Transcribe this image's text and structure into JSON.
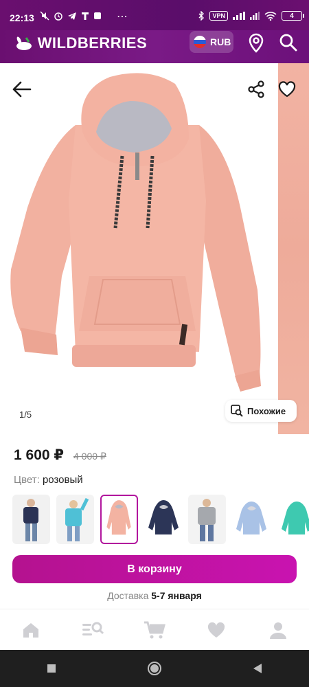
{
  "status_bar": {
    "time": "22:13",
    "vpn": "VPN",
    "battery": "4"
  },
  "header": {
    "brand": "WILDBERRIES",
    "currency": "RUB",
    "accent_color": "#6a0f70"
  },
  "gallery": {
    "counter": "1/5",
    "similar_label": "Похожие",
    "main_product_color": "#f3b3a2"
  },
  "product": {
    "price": "1 600 ₽",
    "old_price": "4 000 ₽",
    "color_label": "Цвет:",
    "color_value": "розовый",
    "swatches": [
      {
        "name": "navy-kid",
        "color": "#2b3355"
      },
      {
        "name": "turquoise-kid",
        "color": "#4fc0d6"
      },
      {
        "name": "pink",
        "color": "#f3b3a2",
        "selected": true
      },
      {
        "name": "navy",
        "color": "#2c3557"
      },
      {
        "name": "grey-kid",
        "color": "#a5a8ad"
      },
      {
        "name": "light-blue",
        "color": "#a9c2e6"
      },
      {
        "name": "mint",
        "color": "#3ec9b0"
      }
    ]
  },
  "actions": {
    "cart_label": "В корзину",
    "cart_color": "#c913b0",
    "delivery_label": "Доставка",
    "delivery_date": "5-7 января"
  },
  "bottom_nav": {
    "items": [
      "home-icon",
      "catalog-search-icon",
      "cart-icon",
      "favorites-icon",
      "profile-icon"
    ]
  }
}
